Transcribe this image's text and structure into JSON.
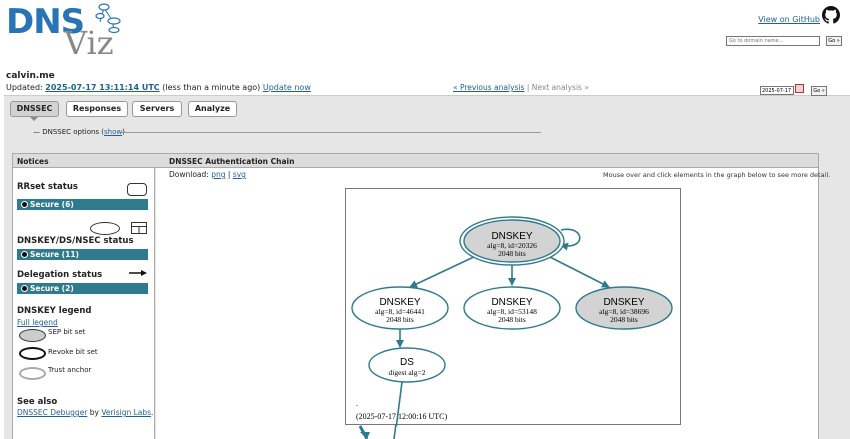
{
  "header": {
    "logo_dns": "DNS",
    "logo_viz": "Viz",
    "github_link": "View on GitHub",
    "domain_placeholder": "Go to domain name...",
    "go_label": "Go »"
  },
  "analysis": {
    "domain": "calvin.me",
    "updated_prefix": "Updated:",
    "updated_date": "2025-07-17 13:11:14 UTC",
    "updated_relative_open": "(",
    "updated_relative": "less than a minute ago",
    "updated_relative_close": ")",
    "update_now": "Update now",
    "prev_analysis": "« Previous analysis",
    "separator": "|",
    "next_analysis": "Next analysis »",
    "date_value": "2025-07-17",
    "go_label": "Go »"
  },
  "tabs": [
    {
      "label": "DNSSEC",
      "active": true
    },
    {
      "label": "Responses",
      "active": false
    },
    {
      "label": "Servers",
      "active": false
    },
    {
      "label": "Analyze",
      "active": false
    }
  ],
  "options": {
    "prefix": "— DNSSEC options (",
    "show": "show",
    "suffix": ")"
  },
  "notices": {
    "header": "Notices",
    "rrset_title": "RRset status",
    "rrset_bar": "Secure (6)",
    "dnskey_title": "DNSKEY/DS/NSEC status",
    "dnskey_bar": "Secure (11)",
    "delegation_title": "Delegation status",
    "delegation_bar": "Secure (2)",
    "legend_title": "DNSKEY legend",
    "full_legend": "Full legend",
    "sep": "SEP bit set",
    "revoke": "Revoke bit set",
    "trust": "Trust anchor",
    "see_also": "See also",
    "debugger": "DNSSEC Debugger",
    "by": "by",
    "verisign": "Verisign Labs",
    "period": "."
  },
  "chain": {
    "header": "DNSSEC Authentication Chain",
    "download": "Download:",
    "png": "png",
    "sep": "|",
    "svg": "svg",
    "mouseover": "Mouse over and click elements in the graph below to see more detail.",
    "dot": ".",
    "timestamp": "(2025-07-17 12:00:16 UTC)",
    "nodes": [
      {
        "title": "DNSKEY",
        "line1": "alg=8, id=20326",
        "line2": "2048 bits"
      },
      {
        "title": "DNSKEY",
        "line1": "alg=8, id=46441",
        "line2": "2048 bits"
      },
      {
        "title": "DNSKEY",
        "line1": "alg=8, id=53148",
        "line2": "2048 bits"
      },
      {
        "title": "DNSKEY",
        "line1": "alg=8, id=38696",
        "line2": "2048 bits"
      },
      {
        "title": "DS",
        "line1": "digest alg=2"
      }
    ],
    "edge_color": "#2f7b8d",
    "sep_fill": "#d3d3d3"
  }
}
